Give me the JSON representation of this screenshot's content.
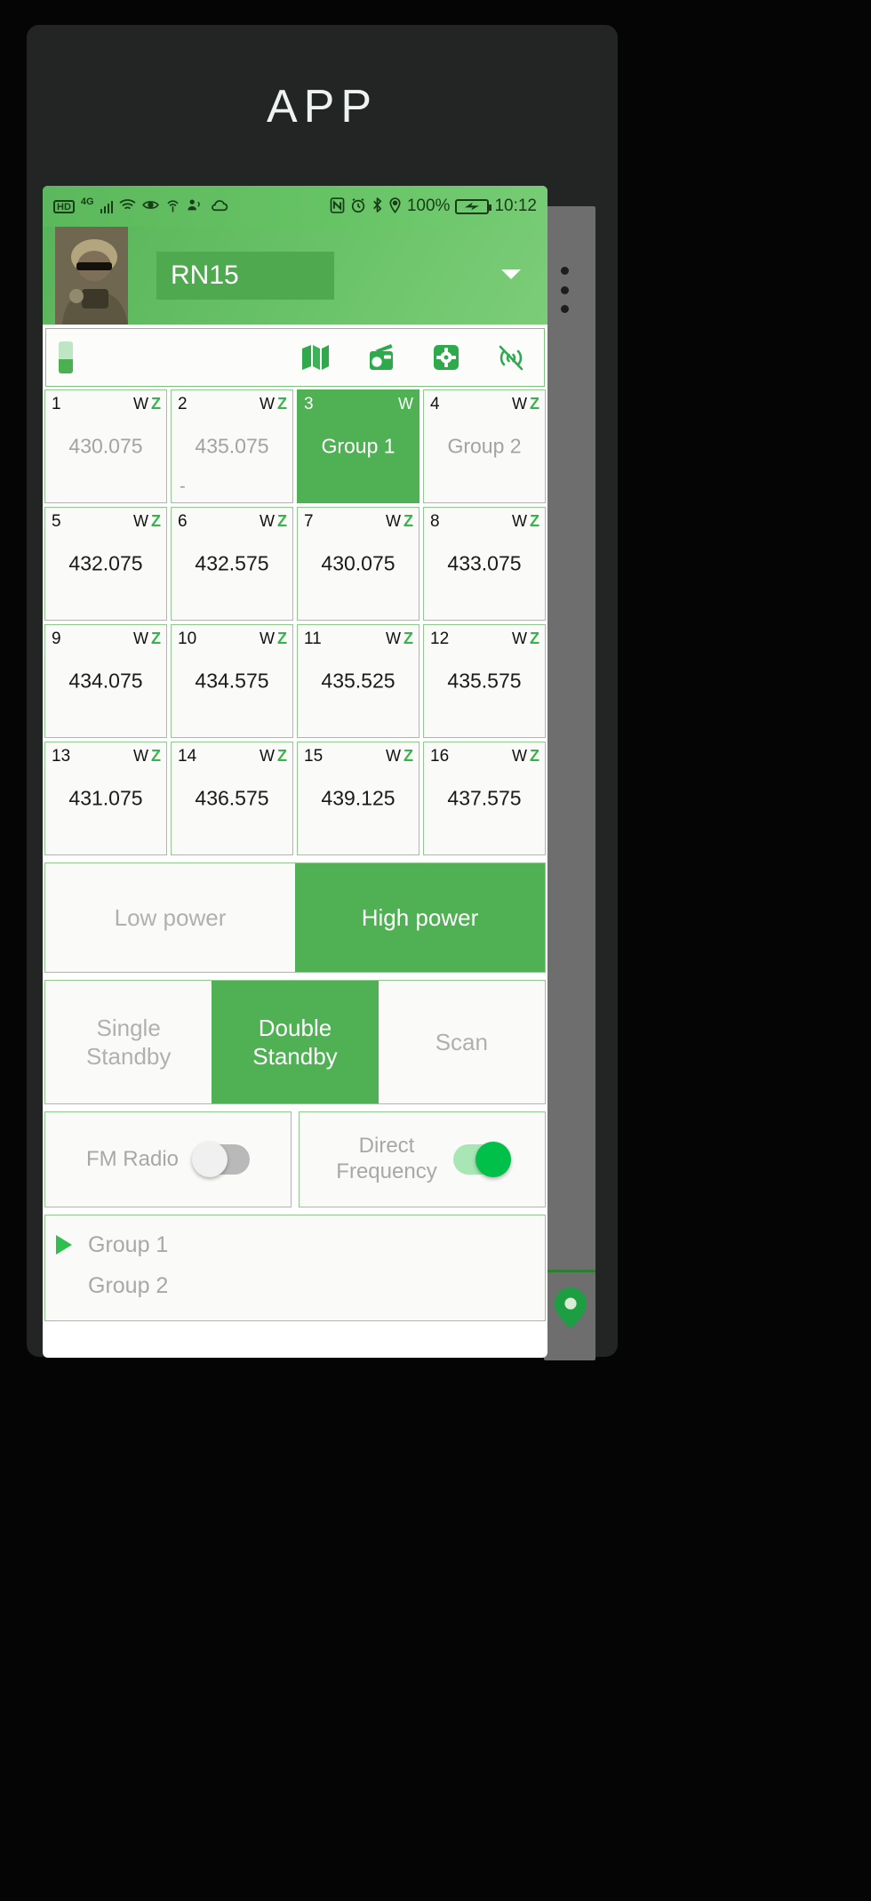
{
  "window": {
    "title": "APP"
  },
  "statusbar": {
    "left_icons": [
      "hd-icon",
      "4g-icon",
      "signal-bars-icon",
      "wifi-icon",
      "eye-care-icon",
      "hotspot-icon",
      "contact-share-icon",
      "cloud-icon"
    ],
    "right_icons": [
      "nfc-icon",
      "alarm-icon",
      "bluetooth-icon",
      "location-icon"
    ],
    "battery_percent": "100%",
    "battery_state": "charging",
    "time": "10:12"
  },
  "header": {
    "avatar": "soldier-photo",
    "device_name": "RN15",
    "dropdown_icon": "caret-down-icon",
    "overflow_icon": "kebab-menu-icon"
  },
  "toolbar": {
    "battery_icon": "battery-level-icon",
    "icons": [
      "map-icon",
      "radio-icon",
      "gear-icon",
      "signal-muted-icon"
    ]
  },
  "channels": {
    "badge_w": "W",
    "badge_z": "Z",
    "cells": [
      {
        "num": "1",
        "value": "430.075",
        "style": "grey",
        "selected": false,
        "dash": false
      },
      {
        "num": "2",
        "value": "435.075",
        "style": "grey",
        "selected": false,
        "dash": true
      },
      {
        "num": "3",
        "value": "Group 1",
        "style": "grey",
        "selected": true,
        "dash": false,
        "no_z": true
      },
      {
        "num": "4",
        "value": "Group 2",
        "style": "grey",
        "selected": false,
        "dash": false
      },
      {
        "num": "5",
        "value": "432.075",
        "style": "dark",
        "selected": false,
        "dash": false
      },
      {
        "num": "6",
        "value": "432.575",
        "style": "dark",
        "selected": false,
        "dash": false
      },
      {
        "num": "7",
        "value": "430.075",
        "style": "dark",
        "selected": false,
        "dash": false
      },
      {
        "num": "8",
        "value": "433.075",
        "style": "dark",
        "selected": false,
        "dash": false
      },
      {
        "num": "9",
        "value": "434.075",
        "style": "dark",
        "selected": false,
        "dash": false
      },
      {
        "num": "10",
        "value": "434.575",
        "style": "dark",
        "selected": false,
        "dash": false
      },
      {
        "num": "11",
        "value": "435.525",
        "style": "dark",
        "selected": false,
        "dash": false
      },
      {
        "num": "12",
        "value": "435.575",
        "style": "dark",
        "selected": false,
        "dash": false
      },
      {
        "num": "13",
        "value": "431.075",
        "style": "dark",
        "selected": false,
        "dash": false
      },
      {
        "num": "14",
        "value": "436.575",
        "style": "dark",
        "selected": false,
        "dash": false
      },
      {
        "num": "15",
        "value": "439.125",
        "style": "dark",
        "selected": false,
        "dash": false
      },
      {
        "num": "16",
        "value": "437.575",
        "style": "dark",
        "selected": false,
        "dash": false
      }
    ]
  },
  "power": {
    "low_label": "Low power",
    "high_label": "High power",
    "selected": "High power"
  },
  "standby": {
    "single_label": "Single\nStandby",
    "single_line1": "Single",
    "single_line2": "Standby",
    "double_line1": "Double",
    "double_line2": "Standby",
    "scan_label": "Scan",
    "selected": "Double Standby"
  },
  "toggles": [
    {
      "label": "FM Radio",
      "line1": "FM Radio",
      "line2": "",
      "state": "off"
    },
    {
      "label": "Direct Frequency",
      "line1": "Direct",
      "line2": "Frequency",
      "state": "on"
    }
  ],
  "group_list": {
    "items": [
      {
        "label": "Group 1",
        "playing": true
      },
      {
        "label": "Group 2",
        "playing": false
      }
    ],
    "play_icon": "play-triangle-icon"
  },
  "colors": {
    "accent_green": "#4fb054",
    "header_green": "#6cc46a",
    "toggle_on": "#00c04a",
    "cell_border": "#8fcb8f",
    "shell_dark": "#232525"
  }
}
